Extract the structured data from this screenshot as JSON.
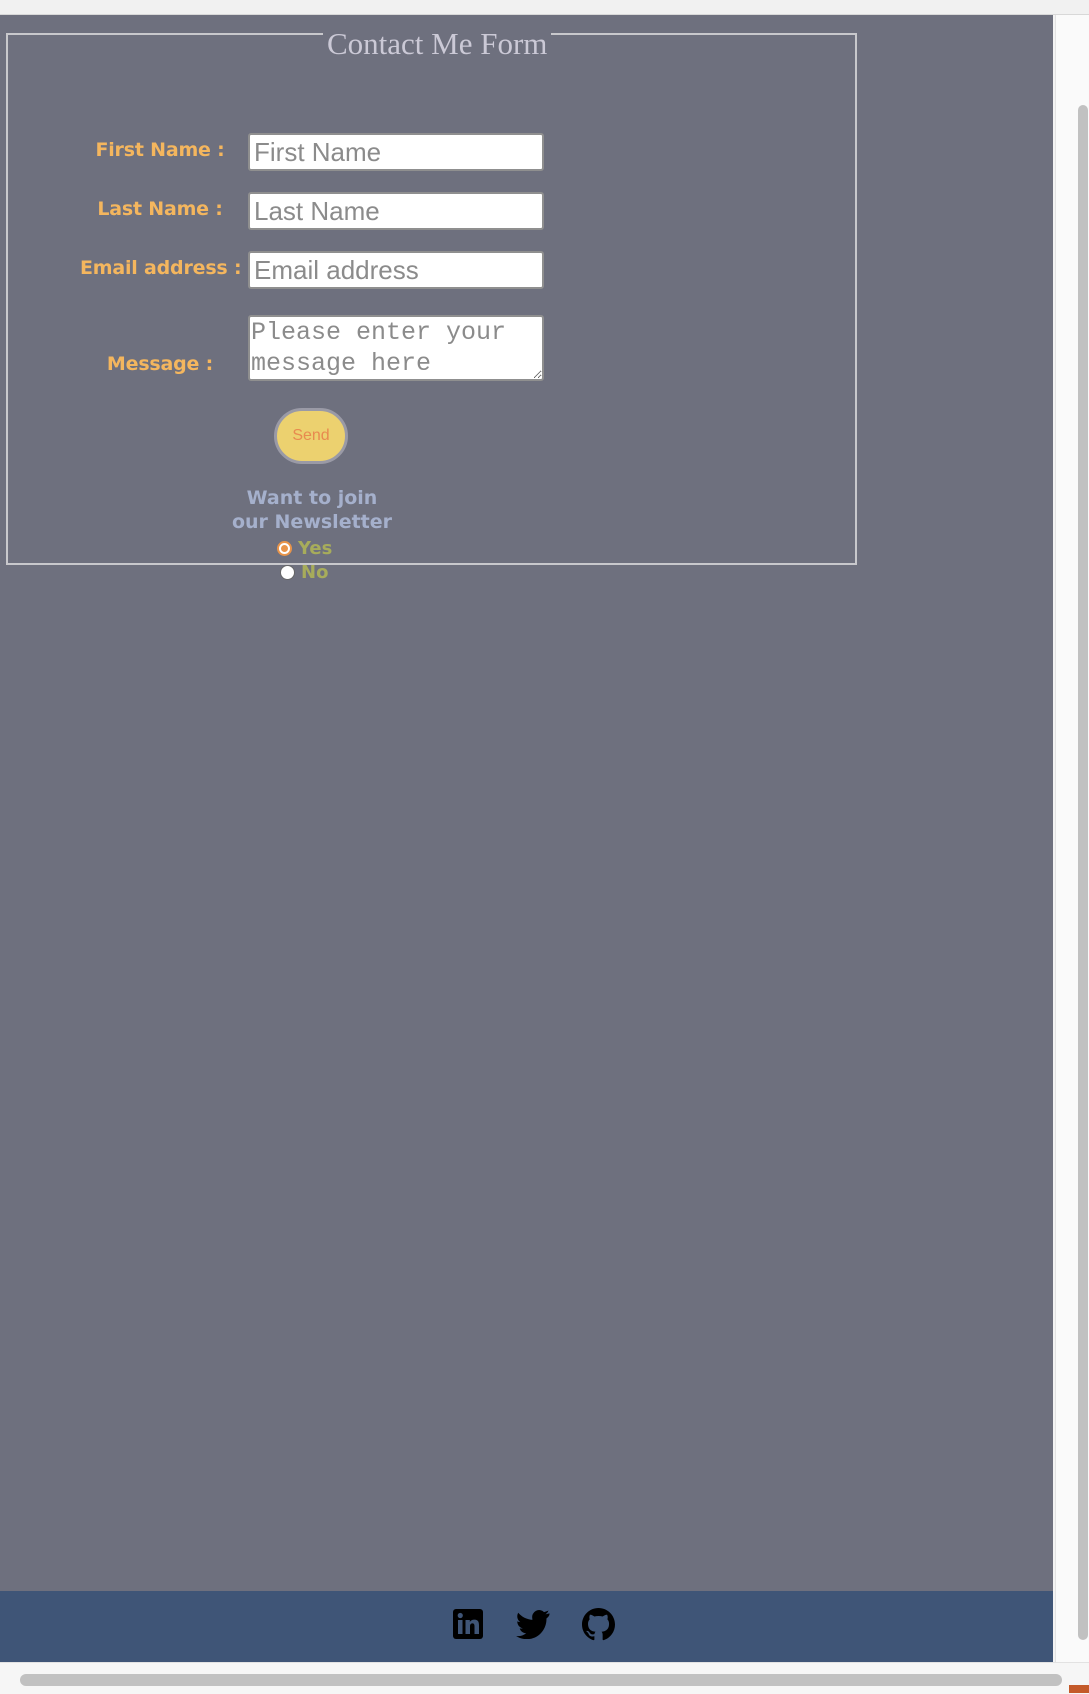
{
  "form": {
    "legend": "Contact Me Form",
    "first_name": {
      "label": "First Name :",
      "placeholder": "First Name"
    },
    "last_name": {
      "label": "Last Name :",
      "placeholder": "Last Name"
    },
    "email": {
      "label": "Email address :",
      "placeholder": "Email address"
    },
    "message": {
      "label": "Message :",
      "placeholder": "Please enter your message here"
    },
    "send_label": "Send",
    "newsletter": {
      "line1": "Want to join",
      "line2": "our Newsletter",
      "options": [
        {
          "label": "Yes",
          "checked": true
        },
        {
          "label": "No",
          "checked": false
        }
      ]
    }
  },
  "footer": {
    "icons": [
      "linkedin-icon",
      "twitter-icon",
      "github-icon"
    ]
  },
  "colors": {
    "page_background": "#6e707e",
    "label": "#f4b65e",
    "footer": "#3f5577",
    "send_button": "#ecd16f"
  }
}
